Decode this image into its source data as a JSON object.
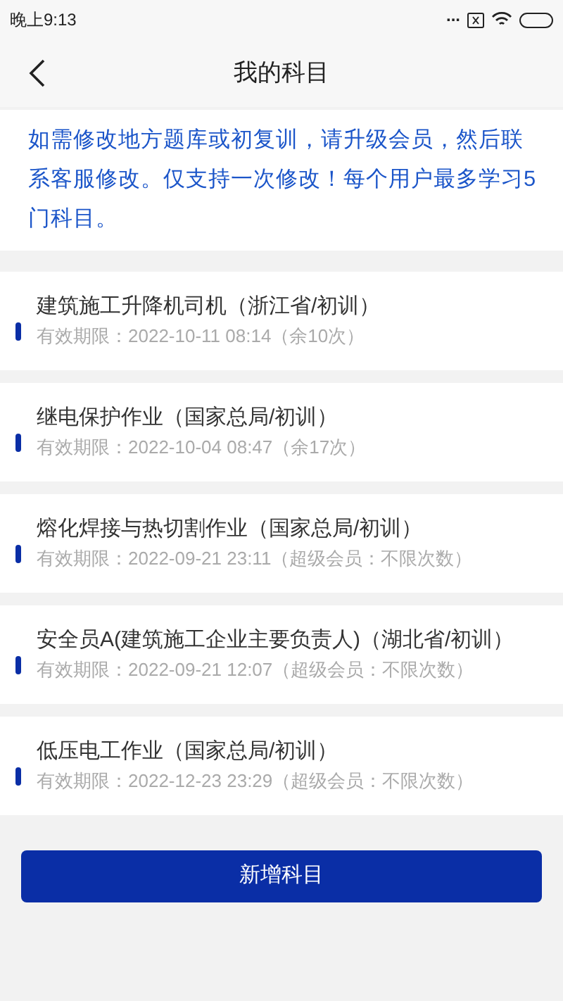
{
  "status_bar": {
    "time": "晚上9:13",
    "more": "..."
  },
  "header": {
    "title": "我的科目"
  },
  "notice": "如需修改地方题库或初复训，请升级会员，然后联系客服修改。仅支持一次修改！每个用户最多学习5门科目。",
  "subjects": [
    {
      "title": "建筑施工升降机司机（浙江省/初训）",
      "validity": "有效期限：2022-10-11 08:14（余10次）"
    },
    {
      "title": "继电保护作业（国家总局/初训）",
      "validity": "有效期限：2022-10-04 08:47（余17次）"
    },
    {
      "title": "熔化焊接与热切割作业（国家总局/初训）",
      "validity": "有效期限：2022-09-21 23:11（超级会员：不限次数）"
    },
    {
      "title": "安全员A(建筑施工企业主要负责人)（湖北省/初训）",
      "validity": "有效期限：2022-09-21 12:07（超级会员：不限次数）"
    },
    {
      "title": "低压电工作业（国家总局/初训）",
      "validity": "有效期限：2022-12-23 23:29（超级会员：不限次数）"
    }
  ],
  "add_button": "新增科目"
}
